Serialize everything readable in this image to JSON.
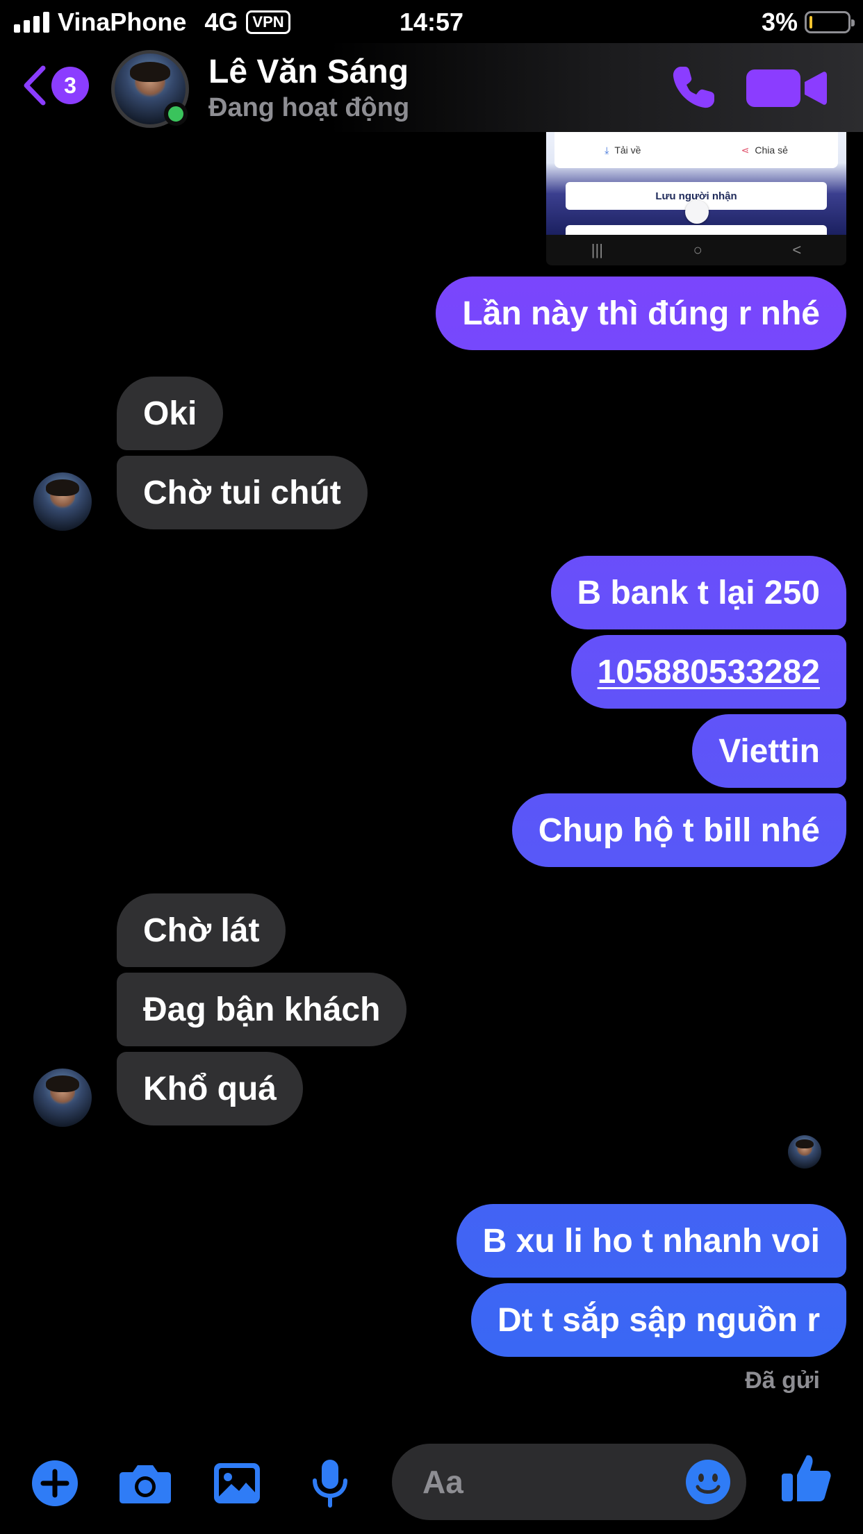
{
  "status_bar": {
    "carrier": "VinaPhone",
    "network": "4G",
    "vpn": "VPN",
    "time": "14:57",
    "battery_percent": "3%",
    "battery_level": 0.03
  },
  "header": {
    "back_badge_count": "3",
    "contact_name": "Lê Văn Sáng",
    "contact_status": "Đang hoạt động"
  },
  "shared_image": {
    "download_label": "Tải về",
    "share_label": "Chia sẻ",
    "save_label": "Lưu người nhận",
    "nav_recent": "|||",
    "nav_home": "○",
    "nav_back": "<"
  },
  "messages": [
    {
      "from": "me",
      "text": "Lần này thì đúng r nhé"
    },
    {
      "from": "them",
      "text": "Oki"
    },
    {
      "from": "them",
      "text": "Chờ tui chút"
    },
    {
      "from": "me",
      "text": "B bank t lại 250"
    },
    {
      "from": "me",
      "text": "105880533282"
    },
    {
      "from": "me",
      "text": "Viettin"
    },
    {
      "from": "me",
      "text": "Chup hộ t bill nhé"
    },
    {
      "from": "them",
      "text": "Chờ lát"
    },
    {
      "from": "them",
      "text": "Đag bận khách"
    },
    {
      "from": "them",
      "text": "Khổ quá"
    },
    {
      "from": "me",
      "text": "B xu li ho t nhanh voi"
    },
    {
      "from": "me",
      "text": "Dt t sắp sập nguồn r"
    }
  ],
  "delivery_status": "Đã gửi",
  "composer": {
    "placeholder": "Aa"
  },
  "colors": {
    "outgoing_gradient_top": "#8b3dff",
    "outgoing_gradient_bottom": "#2f6df2",
    "incoming_bubble": "#303032",
    "accent": "#8b3dff",
    "composer_icon": "#2f7cf6"
  }
}
